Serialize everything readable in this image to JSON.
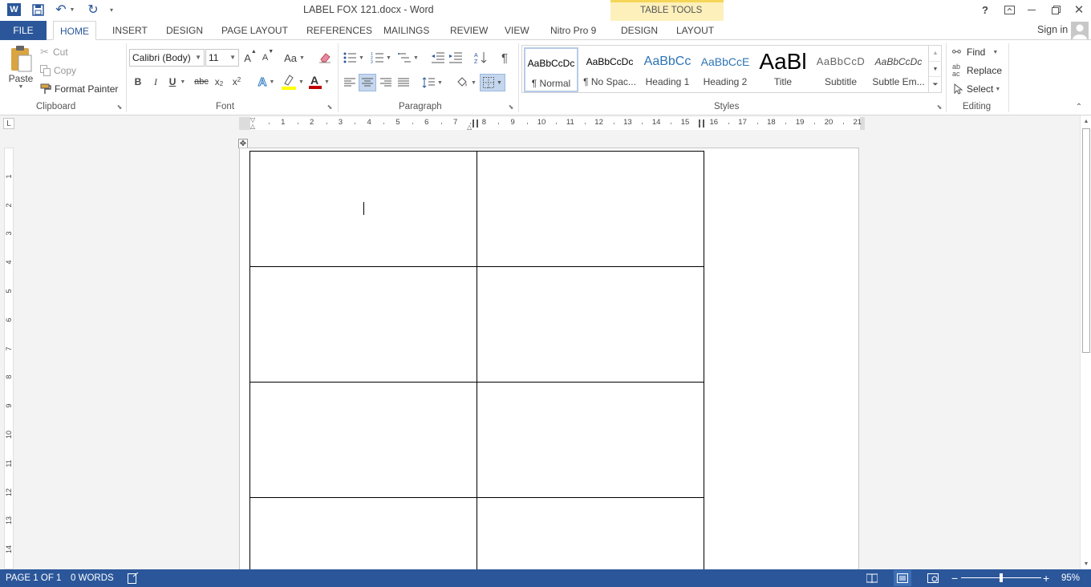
{
  "window": {
    "title": "LABEL FOX 121.docx - Word",
    "context_group": "TABLE TOOLS",
    "help": "?",
    "sign_in": "Sign in"
  },
  "tabs": [
    "FILE",
    "HOME",
    "INSERT",
    "DESIGN",
    "PAGE LAYOUT",
    "REFERENCES",
    "MAILINGS",
    "REVIEW",
    "VIEW",
    "Nitro Pro 9",
    "DESIGN",
    "LAYOUT"
  ],
  "clipboard": {
    "paste": "Paste",
    "cut": "Cut",
    "copy": "Copy",
    "format_painter": "Format Painter",
    "group": "Clipboard"
  },
  "font": {
    "name": "Calibri (Body)",
    "size": "11",
    "grow": "A",
    "shrink": "A",
    "change_case": "Aa",
    "bold": "B",
    "italic": "I",
    "underline": "U",
    "strike": "abc",
    "subscript": "x",
    "superscript": "x",
    "group": "Font"
  },
  "paragraph": {
    "group": "Paragraph"
  },
  "styles": {
    "items": [
      {
        "preview": "AaBbCcDc",
        "name": "¶ Normal"
      },
      {
        "preview": "AaBbCcDc",
        "name": "¶ No Spac..."
      },
      {
        "preview": "AaBbCc",
        "name": "Heading 1"
      },
      {
        "preview": "AaBbCcE",
        "name": "Heading 2"
      },
      {
        "preview": "AaBl",
        "name": "Title"
      },
      {
        "preview": "AaBbCcD",
        "name": "Subtitle"
      },
      {
        "preview": "AaBbCcDc",
        "name": "Subtle Em..."
      }
    ],
    "group": "Styles"
  },
  "editing": {
    "find": "Find",
    "replace": "Replace",
    "select": "Select",
    "group": "Editing"
  },
  "ruler": {
    "h_numbers": [
      "1",
      "2",
      "3",
      "4",
      "5",
      "6",
      "7",
      "8",
      "9",
      "10",
      "11",
      "12",
      "13",
      "14",
      "15",
      "16",
      "17",
      "18",
      "19",
      "20",
      "21"
    ],
    "v_numbers": [
      "1",
      "2",
      "3",
      "4",
      "5",
      "6",
      "7",
      "8",
      "9",
      "10",
      "11",
      "12",
      "13",
      "14"
    ]
  },
  "status": {
    "page": "PAGE 1 OF 1",
    "words": "0 WORDS",
    "zoom": "95%",
    "zoom_level": 0.5
  },
  "colors": {
    "accent": "#2b579a",
    "context_tab": "#fdf0bb",
    "font_color": "#c00000",
    "highlight": "#ffff00"
  }
}
